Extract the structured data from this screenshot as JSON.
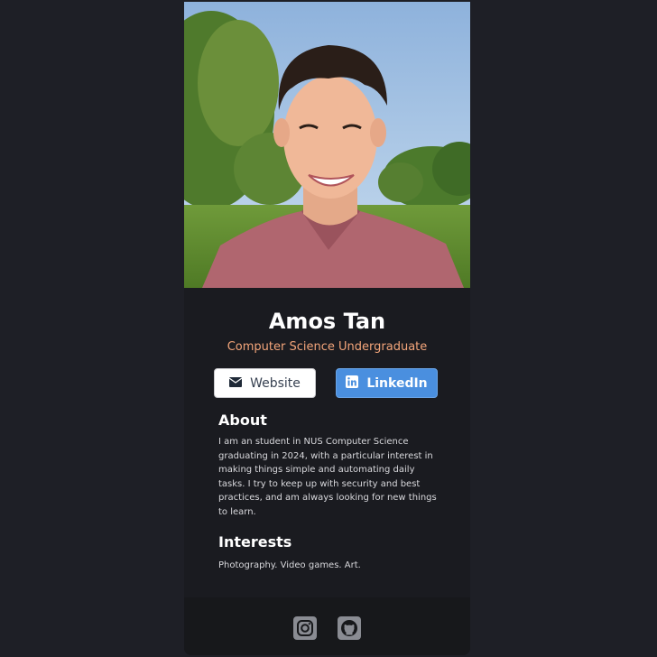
{
  "profile": {
    "name": "Amos Tan",
    "subtitle": "Computer Science Undergraduate",
    "photo_icon": "profile-photo"
  },
  "buttons": {
    "website_label": "Website",
    "website_icon": "envelope-icon",
    "linkedin_label": "LinkedIn",
    "linkedin_icon": "linkedin-icon"
  },
  "about": {
    "title": "About",
    "text": "I am an student in NUS Computer Science graduating in 2024, with a particular interest in making things simple and automating daily tasks. I try to keep up with security and best practices, and am always looking for new things to learn."
  },
  "interests": {
    "title": "Interests",
    "text": "Photography. Video games. Art."
  },
  "footer": {
    "icons": [
      "instagram-icon",
      "github-icon"
    ]
  },
  "colors": {
    "background": "#1e1f26",
    "card": "#1a1b20",
    "footer": "#17181b",
    "accent_subtitle": "#f3a57a",
    "linkedin_blue": "#4a8fdf"
  }
}
